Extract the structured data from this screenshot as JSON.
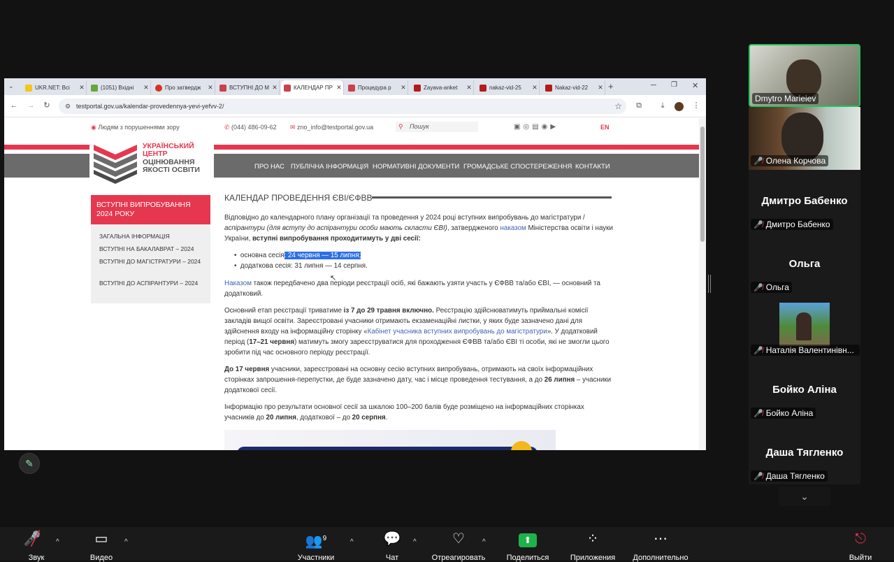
{
  "browser": {
    "tabs": [
      {
        "label": "UKR.NET: Всі",
        "favicon": "#f5c518"
      },
      {
        "label": "(1051) Вхідні",
        "favicon": "#67a53e"
      },
      {
        "label": "Про затвердж",
        "favicon": "#d93025"
      },
      {
        "label": "ВСТУПНІ ДО М",
        "favicon": "#c8414c"
      },
      {
        "label": "КАЛЕНДАР ПР",
        "favicon": "#c8414c"
      },
      {
        "label": "Процедура р",
        "favicon": "#c8414c"
      },
      {
        "label": "Zayava-anket",
        "favicon": "#b31b1b"
      },
      {
        "label": "nakaz-vid-25",
        "favicon": "#b31b1b"
      },
      {
        "label": "Nakaz-vid-22",
        "favicon": "#b31b1b"
      }
    ],
    "url": "testportal.gov.ua/kalendar-provedennya-yevi-yefvv-2/"
  },
  "site": {
    "accessibility": "Людям з порушеннями зору",
    "phone": "(044) 486-09-62",
    "email": "zno_info@testportal.gov.ua",
    "search_placeholder": "Пошук",
    "lang": "EN",
    "logo": {
      "line1": "УКРАЇНСЬКИЙ",
      "line2": "ЦЕНТР",
      "line3": "ОЦІНЮВАННЯ",
      "line4": "ЯКОСТІ ОСВІТИ"
    },
    "nav": [
      "ПРО НАС",
      "ПУБЛІЧНА ІНФОРМАЦІЯ",
      "НОРМАТИВНІ ДОКУМЕНТИ",
      "ГРОМАДСЬКЕ СПОСТЕРЕЖЕННЯ",
      "КОНТАКТИ"
    ],
    "sidebar": {
      "heading": "ВСТУПНІ ВИПРОБУВАННЯ 2024 РОКУ",
      "items": [
        "ЗАГАЛЬНА ІНФОРМАЦІЯ",
        "ВСТУПНІ НА БАКАЛАВРАТ – 2024",
        "ВСТУПНІ ДО МАГІСТРАТУРИ – 2024",
        "ВСТУПНІ ДО АСПІРАНТУРИ – 2024"
      ]
    },
    "content": {
      "title": "КАЛЕНДАР ПРОВЕДЕННЯ ЄВІ/ЄФВВ",
      "p1a": "Відповідно до календарного плану організації та проведення у 2024 році вступних випробувань до магістратури / ",
      "p1b": "аспірантури (для вступу до аспірантури особи мають скласти ЄВІ)",
      "p1c": ", затвердженого ",
      "p1link": "наказом",
      "p1d": " Міністерства освіти і науки України, ",
      "p1bold": "вступні випробування проходитимуть у дві сесії:",
      "li1a": "основна сесія",
      "li1sel": ": 24 червня —  15 липня;",
      "li2": "додаткова сесія: 31 липня —  14 серпня.",
      "p2link": "Наказом",
      "p2": " також передбачено два періоди реєстрації осіб, які бажають узяти участь у ЄФВВ та/або ЄВІ, — основний та додатковий.",
      "p3a": "Основний етап реєстрації триватиме ",
      "p3b": "із 7 до 29 травня включно.",
      "p3c": " Реєстрацію здійснюватимуть приймальні комісії закладів вищої освіти. Зареєстровані учасники отримають екзаменаційні листки, у яких буде зазначено дані для здійснення входу на інформаційну сторінку «",
      "p3link": "Кабінет учасника вступних випробувань до магістратури",
      "p3d": "». У додатковий період (",
      "p3e": "17–21 червня",
      "p3f": ") матимуть змогу зареєструватися для проходження ЄФВВ та/або ЄВІ ті особи, які не змогли цього зробити під час основного періоду реєстрації.",
      "p4a": "До 17 червня",
      "p4b": " учасники, зареєстровані на основну сесію вступних випробувань, отримають на своїх інформаційних сторінках запрошення-перепустки, де буде зазначено дату, час і місце проведення тестування, а до ",
      "p4c": "26 липня",
      "p4d": " – учасники додаткової сесії.",
      "p5a": "Інформацію про результати основної сесії за шкалою 100–200 балів буде розміщено на інформаційних сторінках учасників до ",
      "p5b": "20 липня",
      "p5c": ", додаткової – до ",
      "p5d": "20 серпня",
      "p5e": "."
    }
  },
  "participants": [
    {
      "name": "Dmytro Marieiev"
    },
    {
      "name": "Олена Корчова"
    },
    {
      "name": "Дмитро Бабенко"
    },
    {
      "name": "Ольга"
    },
    {
      "name": "Наталія Валентинівн..."
    },
    {
      "name": "Бойко Аліна"
    },
    {
      "name": "Даша Тягленко"
    }
  ],
  "toolbar": {
    "audio": "Звук",
    "video": "Видео",
    "participants": "Участники",
    "participants_count": "9",
    "chat": "Чат",
    "react": "Отреагировать",
    "share": "Поделиться",
    "apps": "Приложения",
    "more": "Дополнительно",
    "leave": "Выйти"
  },
  "colors": {
    "accent_red": "#e5384f",
    "link": "#3f66b0",
    "share_green": "#1db24b",
    "active_speaker": "#27c25b"
  }
}
